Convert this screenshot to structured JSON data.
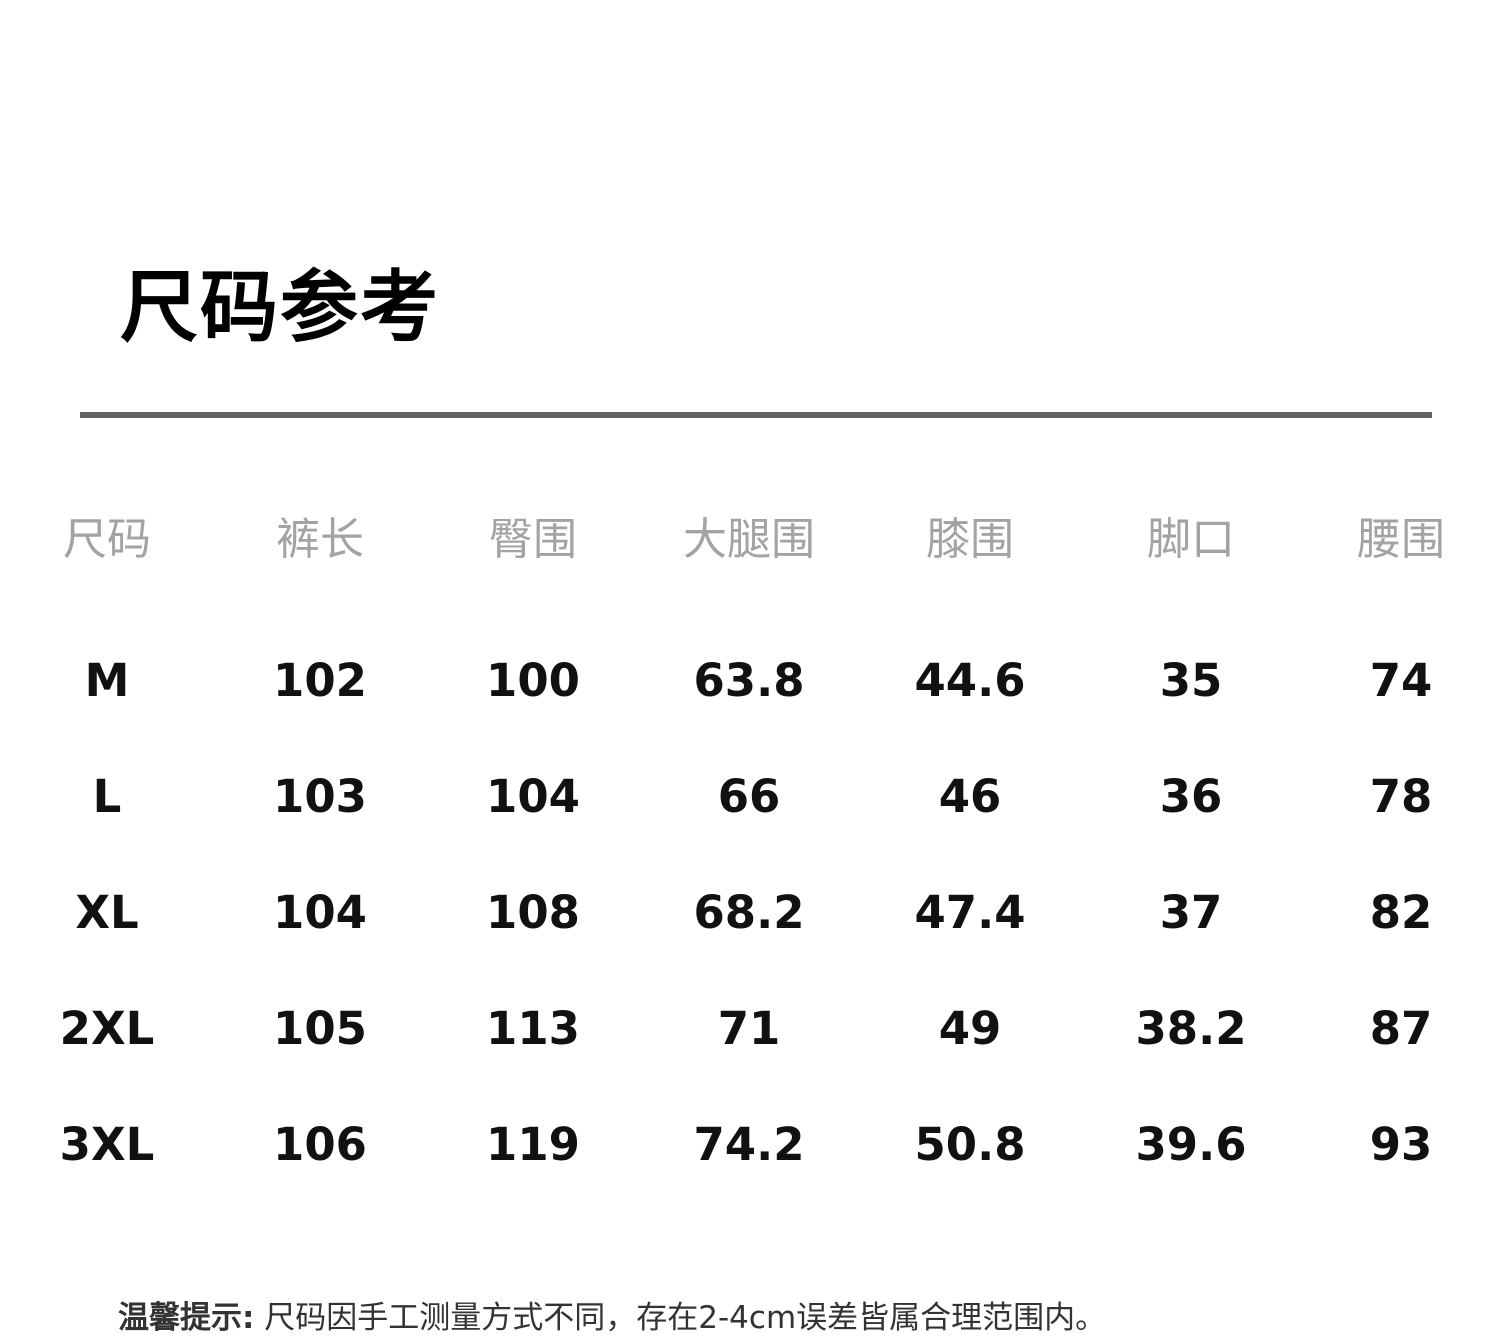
{
  "title": "尺码参考",
  "table": {
    "headers": [
      "尺码",
      "裤长",
      "臀围",
      "大腿围",
      "膝围",
      "脚口",
      "腰围"
    ],
    "rows": [
      [
        "M",
        "102",
        "100",
        "63.8",
        "44.6",
        "35",
        "74"
      ],
      [
        "L",
        "103",
        "104",
        "66",
        "46",
        "36",
        "78"
      ],
      [
        "XL",
        "104",
        "108",
        "68.2",
        "47.4",
        "37",
        "82"
      ],
      [
        "2XL",
        "105",
        "113",
        "71",
        "49",
        "38.2",
        "87"
      ],
      [
        "3XL",
        "106",
        "119",
        "74.2",
        "50.8",
        "39.6",
        "93"
      ]
    ]
  },
  "note": {
    "label": "温馨提示:",
    "text": "尺码因手工测量方式不同，存在2-4cm误差皆属合理范围内。"
  },
  "colors": {
    "header_text": "#a3a3a3",
    "divider": "#636363",
    "value_text": "#111111"
  }
}
